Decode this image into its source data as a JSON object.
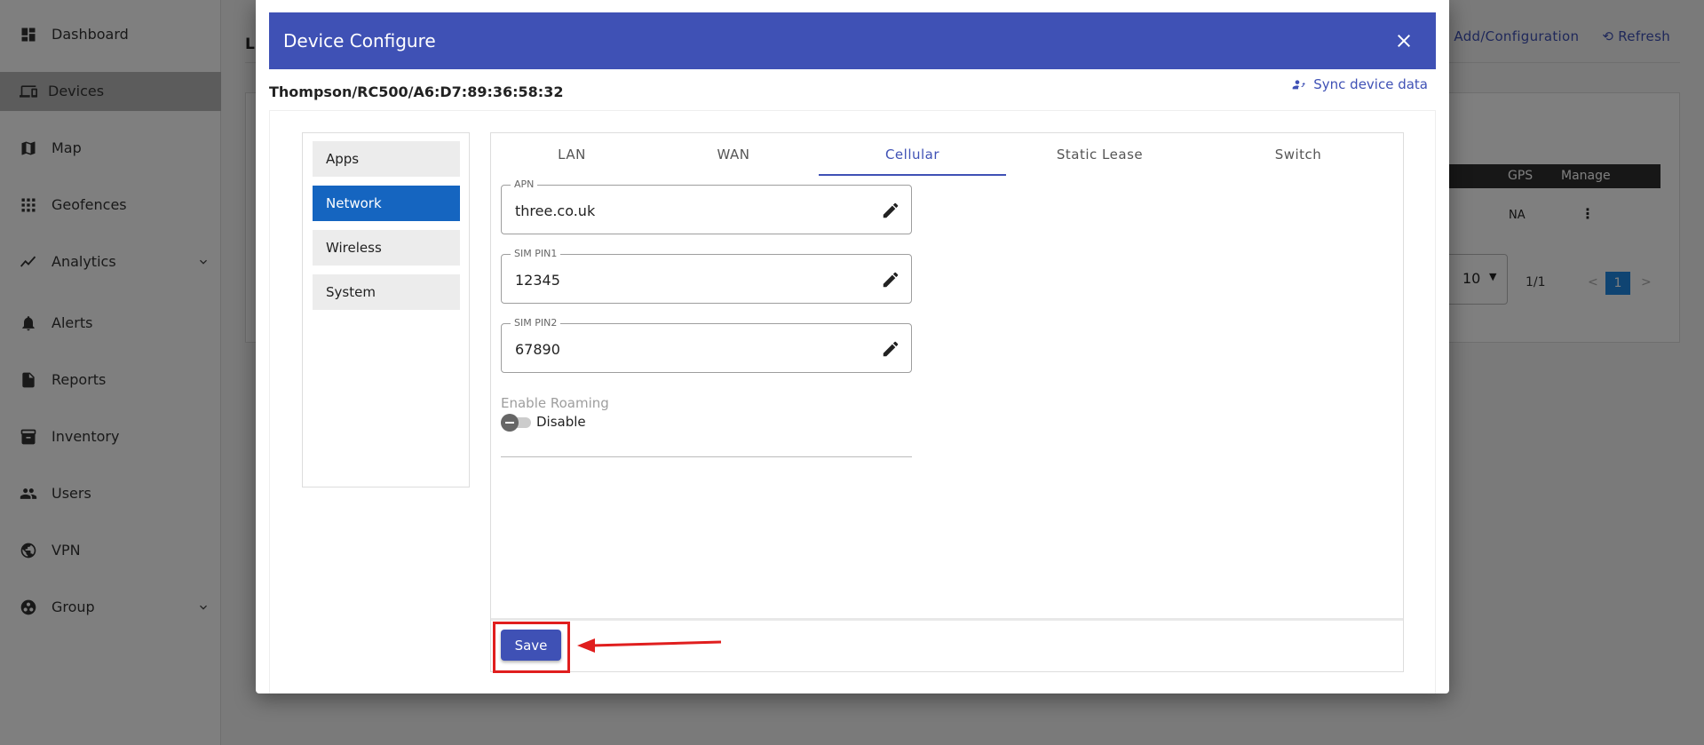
{
  "sidebar": {
    "items": [
      {
        "label": "Dashboard",
        "icon": "dashboard-icon"
      },
      {
        "label": "Devices",
        "icon": "devices-icon"
      },
      {
        "label": "Map",
        "icon": "map-icon"
      },
      {
        "label": "Geofences",
        "icon": "geofences-icon"
      },
      {
        "label": "Analytics",
        "icon": "analytics-icon"
      },
      {
        "label": "Alerts",
        "icon": "bell-icon"
      },
      {
        "label": "Reports",
        "icon": "reports-icon"
      },
      {
        "label": "Inventory",
        "icon": "inventory-icon"
      },
      {
        "label": "Users",
        "icon": "users-icon"
      },
      {
        "label": "VPN",
        "icon": "vpn-icon"
      },
      {
        "label": "Group",
        "icon": "group-icon"
      }
    ],
    "active": "Devices"
  },
  "background": {
    "title": "Li",
    "actions": {
      "add_config": "Add/Configuration",
      "refresh": "Refresh"
    },
    "table": {
      "headers": [
        "GPS",
        "Manage"
      ],
      "row": {
        "gps": "NA"
      }
    },
    "rows_per_page": "10",
    "page_info": "1/1",
    "prev": "<",
    "next": ">",
    "current_page": "1"
  },
  "modal": {
    "title": "Device Configure",
    "device_id": "Thompson/RC500/A6:D7:89:36:58:32",
    "sync_label": "Sync device data",
    "menu": [
      "Apps",
      "Network",
      "Wireless",
      "System"
    ],
    "active_menu": "Network",
    "tabs": [
      "LAN",
      "WAN",
      "Cellular",
      "Static Lease",
      "Switch"
    ],
    "active_tab": "Cellular",
    "fields": {
      "apn": {
        "label": "APN",
        "value": "three.co.uk"
      },
      "sim_pin1": {
        "label": "SIM PIN1",
        "value": "12345"
      },
      "sim_pin2": {
        "label": "SIM PIN2",
        "value": "67890"
      }
    },
    "roaming": {
      "label": "Enable Roaming",
      "state": "Disable"
    },
    "save_label": "Save"
  },
  "colors": {
    "primary": "#3f51b5",
    "active_menu": "#1565c0",
    "highlight": "#e01e1e",
    "overlay": "rgba(0,0,0,0.5)"
  }
}
